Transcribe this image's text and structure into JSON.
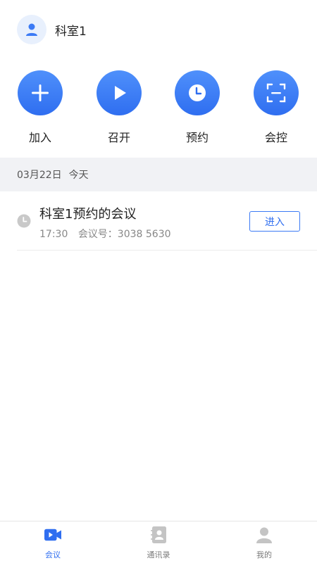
{
  "header": {
    "title": "科室1",
    "avatar_icon": "person-icon"
  },
  "actions": [
    {
      "label": "加入",
      "icon": "plus-icon"
    },
    {
      "label": "召开",
      "icon": "play-icon"
    },
    {
      "label": "预约",
      "icon": "clock-icon"
    },
    {
      "label": "会控",
      "icon": "scan-icon"
    }
  ],
  "date_bar": {
    "date": "03月22日",
    "day": "今天"
  },
  "meetings": [
    {
      "title": "科室1预约的会议",
      "time": "17:30",
      "meeting_no": "会议号：3038 5630",
      "enter_label": "进入"
    }
  ],
  "tabs": [
    {
      "label": "会议",
      "icon": "video-camera-icon",
      "active": true
    },
    {
      "label": "通讯录",
      "icon": "contacts-book-icon",
      "active": false
    },
    {
      "label": "我的",
      "icon": "user-icon",
      "active": false
    }
  ],
  "colors": {
    "accent": "#2f6ef0",
    "accent_light": "#4f90fb",
    "date_bar_bg": "#f1f2f5",
    "inactive_icon": "#c4c4c4"
  }
}
